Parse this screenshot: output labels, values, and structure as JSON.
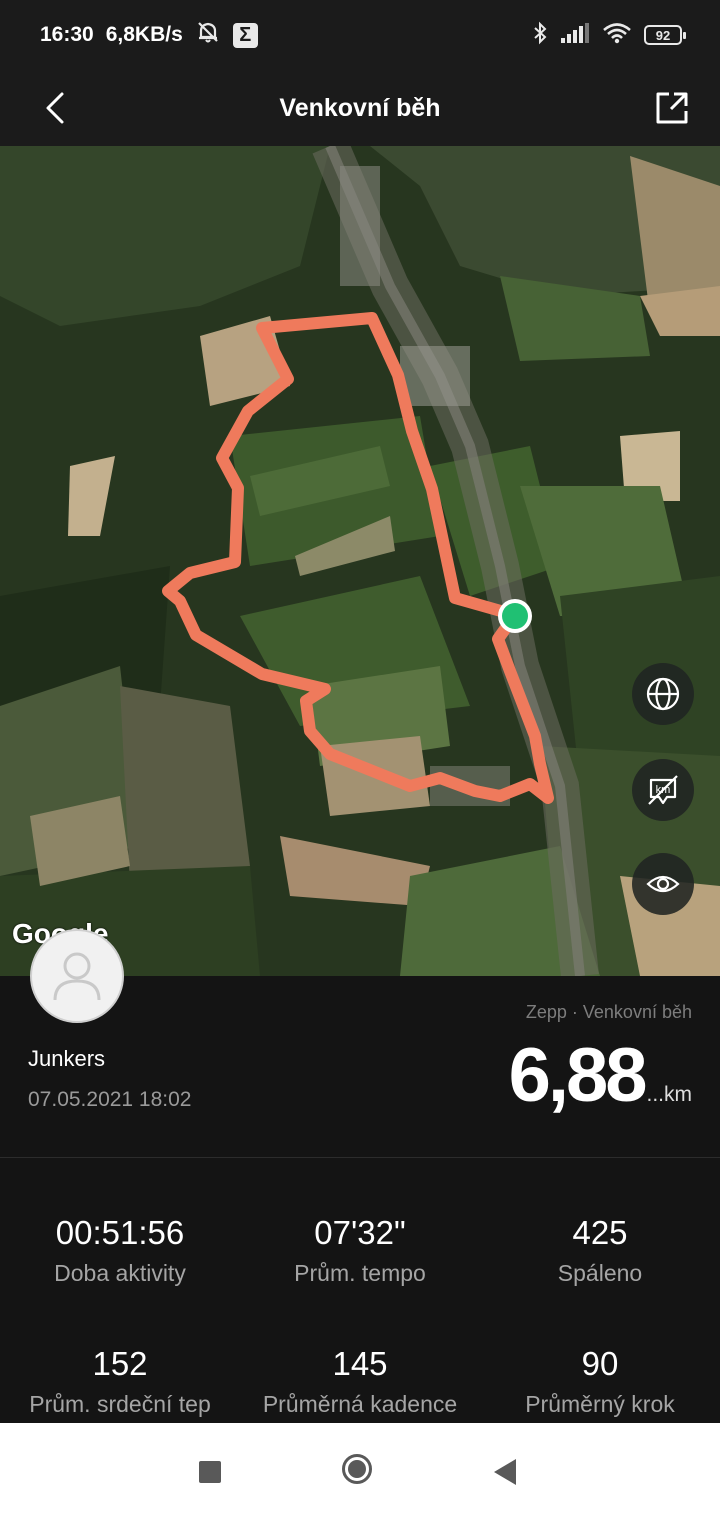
{
  "status_bar": {
    "time": "16:30",
    "network_speed": "6,8KB/s",
    "battery": "92",
    "icons": [
      "mute-bell-icon",
      "sigma-app-icon",
      "bluetooth-icon",
      "signal-icon",
      "wifi-icon",
      "battery-icon"
    ]
  },
  "header": {
    "title": "Venkovní běh",
    "icons": [
      "back-arrow-icon",
      "share-icon"
    ]
  },
  "map": {
    "attribution": "Google",
    "route_color": "#ef7a5c",
    "marker_color": "#20c073",
    "buttons": [
      "globe-icon",
      "km-marker-toggle-icon",
      "eye-icon"
    ]
  },
  "activity": {
    "user_name": "Junkers",
    "datetime": "07.05.2021 18:02",
    "source": "Zepp · Venkovní běh",
    "distance": "6,88",
    "distance_unit": "...km"
  },
  "stats": [
    {
      "value": "00:51:56",
      "label": "Doba aktivity"
    },
    {
      "value": "07'32\"",
      "label": "Prům. tempo"
    },
    {
      "value": "425",
      "label": "Spáleno"
    },
    {
      "value": "152",
      "label": "Prům. srdeční tep"
    },
    {
      "value": "145",
      "label": "Průměrná kadence"
    },
    {
      "value": "90",
      "label": "Průměrný krok"
    }
  ],
  "navigation": [
    "recent-apps-icon",
    "home-icon",
    "back-icon"
  ]
}
